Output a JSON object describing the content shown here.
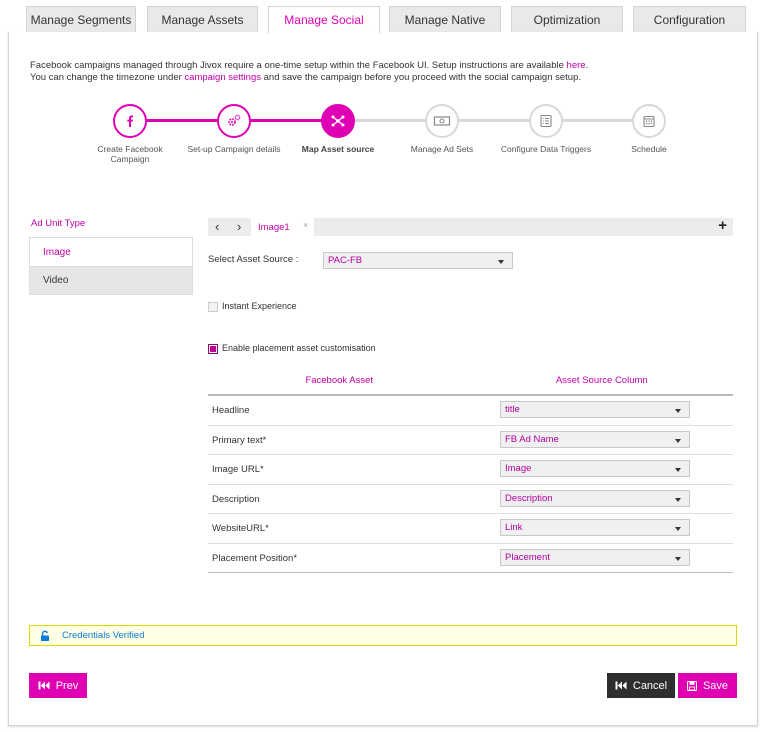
{
  "tabs": [
    {
      "label": "Manage Segments",
      "active": false
    },
    {
      "label": "Manage Assets",
      "active": false
    },
    {
      "label": "Manage Social",
      "active": true
    },
    {
      "label": "Manage Native",
      "active": false
    },
    {
      "label": "Optimization",
      "active": false
    },
    {
      "label": "Configuration",
      "active": false
    }
  ],
  "info": {
    "line1_prefix": "Facebook campaigns managed through Jivox require a one-time setup within the Facebook UI. Setup instructions are available ",
    "line1_link": "here",
    "line1_suffix": ".",
    "line2_prefix": "You can change the timezone under ",
    "line2_link": "campaign settings",
    "line2_suffix": " and save the campaign before you proceed with the social campaign setup."
  },
  "steps": [
    {
      "label": "Create Facebook Campaign",
      "icon": "facebook-icon",
      "state": "done"
    },
    {
      "label": "Set-up Campaign details",
      "icon": "gears-icon",
      "state": "done"
    },
    {
      "label": "Map Asset source",
      "icon": "share-nodes-icon",
      "state": "current"
    },
    {
      "label": "Manage Ad Sets",
      "icon": "money-icon",
      "state": "todo"
    },
    {
      "label": "Configure Data Triggers",
      "icon": "list-icon",
      "state": "todo"
    },
    {
      "label": "Schedule",
      "icon": "calendar-icon",
      "state": "todo"
    }
  ],
  "ad_unit": {
    "title": "Ad Unit Type",
    "items": [
      "Image",
      "Video"
    ],
    "selected": "Image"
  },
  "creative_tabs": {
    "prev": "‹",
    "next": "›",
    "tab": "Image1",
    "close": "×",
    "add": "+"
  },
  "asset_source": {
    "label": "Select Asset Source :",
    "value": "PAC-FB"
  },
  "instant_experience": {
    "label": "Instant Experience",
    "checked": false
  },
  "placement_customisation": {
    "label": "Enable placement asset customisation",
    "checked": true
  },
  "mapping": {
    "col1": "Facebook Asset",
    "col2": "Asset Source Column",
    "rows": [
      {
        "name": "Headline",
        "value": "title"
      },
      {
        "name": "Primary text*",
        "value": "FB Ad Name"
      },
      {
        "name": "Image URL*",
        "value": "Image"
      },
      {
        "name": "Description",
        "value": "Description"
      },
      {
        "name": "WebsiteURL*",
        "value": "Link"
      },
      {
        "name": "Placement Position*",
        "value": "Placement"
      }
    ]
  },
  "credentials": {
    "label": "Credentials Verified"
  },
  "buttons": {
    "prev": "Prev",
    "cancel": "Cancel",
    "save": "Save"
  },
  "colors": {
    "accent": "#e000b4",
    "dark": "#2e2e2e",
    "step_inactive": "#d8d8d8",
    "credentials_bg": "#ffffe6"
  }
}
